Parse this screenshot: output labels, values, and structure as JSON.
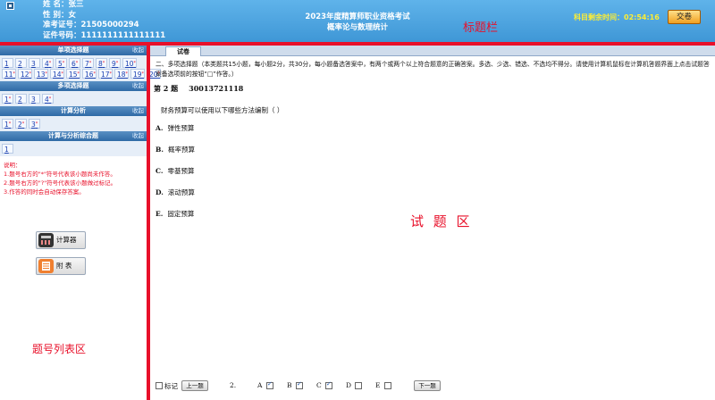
{
  "header": {
    "candidate": {
      "name_label": "姓    名：",
      "name": "张三",
      "gender_label": "性    别：",
      "gender": "女",
      "admission_label": "准考证号：",
      "admission": "21505000294",
      "id_label": "证件号码：",
      "id": "1111111111111111"
    },
    "exam_title": "2023年度精算师职业资格考试",
    "exam_subject": "概率论与数理统计",
    "annotation": "标题栏",
    "timer_label": "科目剩余时间：",
    "timer_value": "02:54:16",
    "submit_label": "交卷"
  },
  "sidebar": {
    "collapse_label": "收起",
    "sections": [
      {
        "title": "单项选择题",
        "rows": [
          [
            {
              "n": "1",
              "m": ""
            },
            {
              "n": "2",
              "m": ""
            },
            {
              "n": "3",
              "m": ""
            },
            {
              "n": "4",
              "m": "*"
            },
            {
              "n": "5",
              "m": "*"
            },
            {
              "n": "6",
              "m": "*"
            },
            {
              "n": "7",
              "m": "*"
            },
            {
              "n": "8",
              "m": "*"
            },
            {
              "n": "9",
              "m": "*"
            },
            {
              "n": "10",
              "m": "*"
            }
          ],
          [
            {
              "n": "11",
              "m": "*"
            },
            {
              "n": "12",
              "m": "*"
            },
            {
              "n": "13",
              "m": "*"
            },
            {
              "n": "14",
              "m": "*"
            },
            {
              "n": "15",
              "m": "*"
            },
            {
              "n": "16",
              "m": "*"
            },
            {
              "n": "17",
              "m": "*"
            },
            {
              "n": "18",
              "m": "*"
            },
            {
              "n": "19",
              "m": "*"
            },
            {
              "n": "20",
              "m": "*"
            }
          ]
        ]
      },
      {
        "title": "多项选择题",
        "rows": [
          [
            {
              "n": "1",
              "m": "*"
            },
            {
              "n": "2",
              "m": ""
            },
            {
              "n": "3",
              "m": ""
            },
            {
              "n": "4",
              "m": "*"
            }
          ]
        ]
      },
      {
        "title": "计算分析",
        "rows": [
          [
            {
              "n": "1",
              "m": "*"
            },
            {
              "n": "2",
              "m": "*"
            },
            {
              "n": "3",
              "m": "*"
            }
          ]
        ]
      },
      {
        "title": "计算与分析综合题",
        "rows": [
          [
            {
              "n": "1",
              "m": ""
            }
          ]
        ]
      }
    ],
    "notes": [
      "说明：",
      "1.题号右方的\"*\"符号代表该小题尚未作答。",
      "2.题号右方的\"?\"符号代表该小题做过标记。",
      "3.作答的同时会自动保存答案。"
    ],
    "calculator_label": "计算器",
    "table_label": "附 表",
    "annotation": "题号列表区"
  },
  "main": {
    "tab_label": "试卷",
    "section_intro": "二、多项选择题（本类题共15小题，每小题2分，共30分，每小题备选答案中，有两个或两个以上符合题意的正确答案。多选、少选、错选、不选均不得分。请使用计算机鼠标在计算机答题界面上点击试题答案备选项前的按钮“□”作答。）",
    "question_number_label": "第 2 题",
    "question_code": "30013721118",
    "question_stem": "财务预算可以使用以下哪些方法编制（   ）",
    "options": [
      {
        "key": "A.",
        "text": "弹性预算"
      },
      {
        "key": "B.",
        "text": "概率预算"
      },
      {
        "key": "C.",
        "text": "零基预算"
      },
      {
        "key": "D.",
        "text": "滚动预算"
      },
      {
        "key": "E.",
        "text": "固定预算"
      }
    ],
    "annotation": "试 题 区"
  },
  "bottom": {
    "mark_label": "标记",
    "prev_label": "上一题",
    "question_index": "2.",
    "answer_options": [
      {
        "key": "A",
        "checked": true
      },
      {
        "key": "B",
        "checked": true
      },
      {
        "key": "C",
        "checked": true
      },
      {
        "key": "D",
        "checked": false
      },
      {
        "key": "E",
        "checked": false
      }
    ],
    "next_label": "下一题"
  }
}
